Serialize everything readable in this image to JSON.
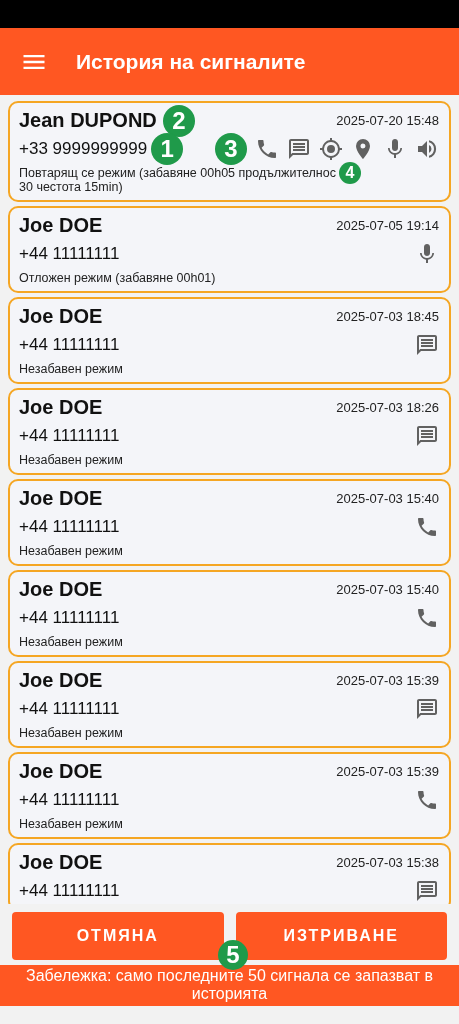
{
  "header": {
    "title": "История на сигналите"
  },
  "signals": [
    {
      "name": "Jean DUPOND",
      "date": "2025-07-20 15:48",
      "phone": "+33 9999999999",
      "description_parts": [
        "Повтарящ се режим (забавяне 00h05 продължителнос",
        "30 честота 15min)"
      ],
      "icons": [
        {
          "kind": "phone"
        },
        {
          "kind": "message"
        },
        {
          "kind": "target"
        },
        {
          "kind": "pin"
        },
        {
          "kind": "mic"
        },
        {
          "kind": "speaker"
        }
      ]
    },
    {
      "name": "Joe DOE",
      "date": "2025-07-05 19:14",
      "phone": "+44 11111111",
      "description_parts": [
        "Отложен режим (забавяне 00h01)"
      ],
      "icons": [
        {
          "kind": "mic"
        }
      ]
    },
    {
      "name": "Joe DOE",
      "date": "2025-07-03 18:45",
      "phone": "+44 11111111",
      "description_parts": [
        "Незабавен режим"
      ],
      "icons": [
        {
          "kind": "message"
        }
      ]
    },
    {
      "name": "Joe DOE",
      "date": "2025-07-03 18:26",
      "phone": "+44 11111111",
      "description_parts": [
        "Незабавен режим"
      ],
      "icons": [
        {
          "kind": "message"
        }
      ]
    },
    {
      "name": "Joe DOE",
      "date": "2025-07-03 15:40",
      "phone": "+44 11111111",
      "description_parts": [
        "Незабавен режим"
      ],
      "icons": [
        {
          "kind": "phone"
        }
      ]
    },
    {
      "name": "Joe DOE",
      "date": "2025-07-03 15:40",
      "phone": "+44 11111111",
      "description_parts": [
        "Незабавен режим"
      ],
      "icons": [
        {
          "kind": "phone"
        }
      ]
    },
    {
      "name": "Joe DOE",
      "date": "2025-07-03 15:39",
      "phone": "+44 11111111",
      "description_parts": [
        "Незабавен режим"
      ],
      "icons": [
        {
          "kind": "message"
        }
      ]
    },
    {
      "name": "Joe DOE",
      "date": "2025-07-03 15:39",
      "phone": "+44 11111111",
      "description_parts": [
        "Незабавен режим"
      ],
      "icons": [
        {
          "kind": "phone"
        }
      ]
    },
    {
      "name": "Joe DOE",
      "date": "2025-07-03 15:38",
      "phone": "+44 11111111",
      "icons": [
        {
          "kind": "message"
        }
      ]
    }
  ],
  "badges": [
    {
      "label": "1"
    },
    {
      "label": "2"
    },
    {
      "label": "3"
    },
    {
      "label": "4"
    },
    {
      "label": "5"
    }
  ],
  "buttons": [
    {
      "label": "ОТМЯНА"
    },
    {
      "label": "ИЗТРИВАНЕ"
    }
  ],
  "note": "Забележка: само последните 50 сигнала се запазват в историята"
}
